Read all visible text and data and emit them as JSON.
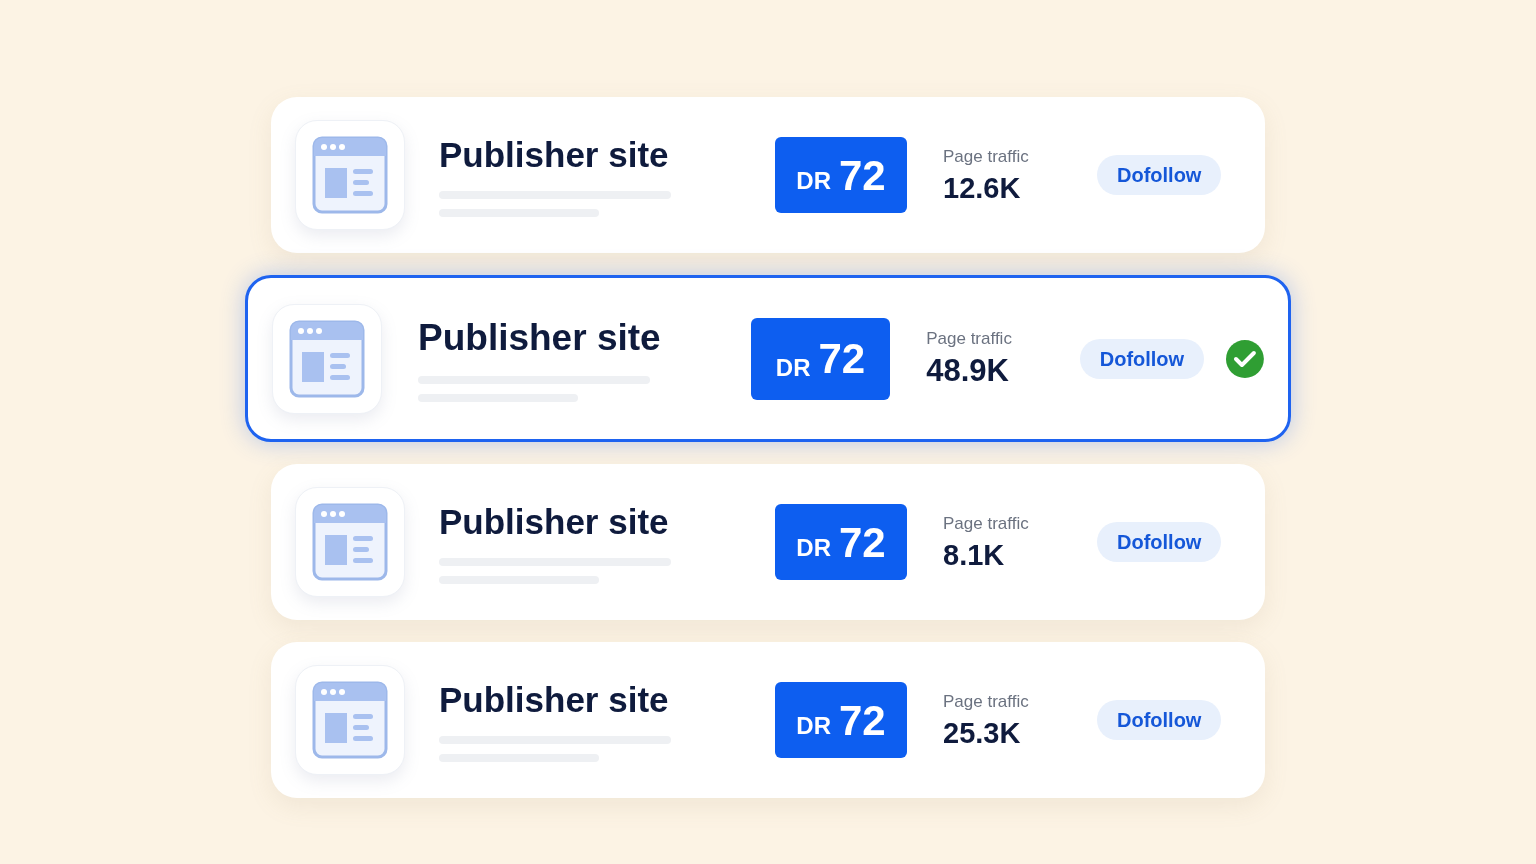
{
  "cards": [
    {
      "title": "Publisher site",
      "dr_label": "DR",
      "dr_value": "72",
      "traffic_label": "Page traffic",
      "traffic_value": "12.6K",
      "tag": "Dofollow",
      "selected": false,
      "verified": false
    },
    {
      "title": "Publisher site",
      "dr_label": "DR",
      "dr_value": "72",
      "traffic_label": "Page traffic",
      "traffic_value": "48.9K",
      "tag": "Dofollow",
      "selected": true,
      "verified": true
    },
    {
      "title": "Publisher site",
      "dr_label": "DR",
      "dr_value": "72",
      "traffic_label": "Page traffic",
      "traffic_value": "8.1K",
      "tag": "Dofollow",
      "selected": false,
      "verified": false
    },
    {
      "title": "Publisher site",
      "dr_label": "DR",
      "dr_value": "72",
      "traffic_label": "Page traffic",
      "traffic_value": "25.3K",
      "tag": "Dofollow",
      "selected": false,
      "verified": false
    }
  ]
}
